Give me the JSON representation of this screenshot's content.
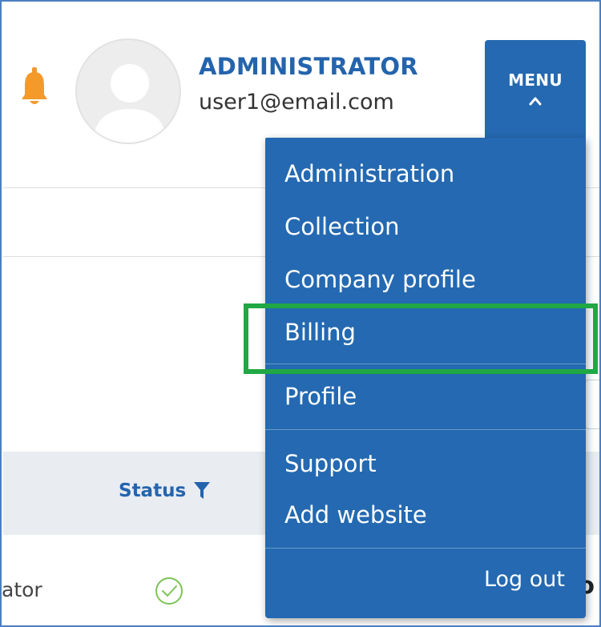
{
  "header": {
    "notification_icon": "bell-icon",
    "avatar_icon": "user-silhouette-icon",
    "user_role": "ADMINISTRATOR",
    "user_email": "user1@email.com",
    "menu_label": "MENU",
    "menu_chevron_icon": "chevron-up-icon",
    "colors": {
      "accent": "#2464ad",
      "menu_bg": "#2469b1",
      "bell": "#f39a2b",
      "highlight": "#1fa843",
      "status_ok": "#7cc456"
    }
  },
  "menu": {
    "items": [
      {
        "label": "Administration"
      },
      {
        "label": "Collection"
      },
      {
        "label": "Company profile"
      },
      {
        "label": "Billing",
        "highlighted": true
      },
      {
        "label": "Profile"
      },
      {
        "label": "Support"
      },
      {
        "label": "Add website"
      }
    ],
    "logout_label": "Log out"
  },
  "table": {
    "status_header": "Status",
    "filter_icon": "filter-icon",
    "row": {
      "role_fragment": "ator",
      "status_icon": "check-circle-icon",
      "trailing_fragment": "o"
    }
  }
}
